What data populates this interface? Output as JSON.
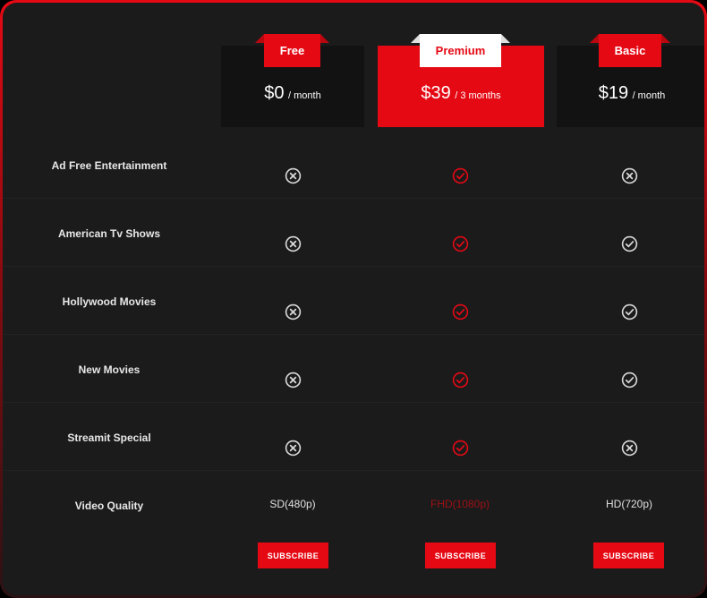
{
  "plans": [
    {
      "name": "Free",
      "amount": "$0",
      "period": "/ month",
      "quality": "SD(480p)",
      "subscribe": "SUBSCRIBE"
    },
    {
      "name": "Premium",
      "amount": "$39",
      "period": "/ 3 months",
      "quality": "FHD(1080p)",
      "subscribe": "SUBSCRIBE"
    },
    {
      "name": "Basic",
      "amount": "$19",
      "period": "/ month",
      "quality": "HD(720p)",
      "subscribe": "SUBSCRIBE"
    }
  ],
  "features": [
    {
      "label": "Ad Free Entertainment",
      "values": [
        "cross",
        "check",
        "cross"
      ]
    },
    {
      "label": "American Tv Shows",
      "values": [
        "cross",
        "check",
        "check"
      ]
    },
    {
      "label": "Hollywood Movies",
      "values": [
        "cross",
        "check",
        "check"
      ]
    },
    {
      "label": "New Movies",
      "values": [
        "cross",
        "check",
        "check"
      ]
    },
    {
      "label": "Streamit Special",
      "values": [
        "cross",
        "check",
        "cross"
      ]
    }
  ],
  "video_quality_label": "Video Quality",
  "colors": {
    "accent": "#e50914",
    "icon": "#d9d9d9",
    "background": "#1b1b1c"
  }
}
